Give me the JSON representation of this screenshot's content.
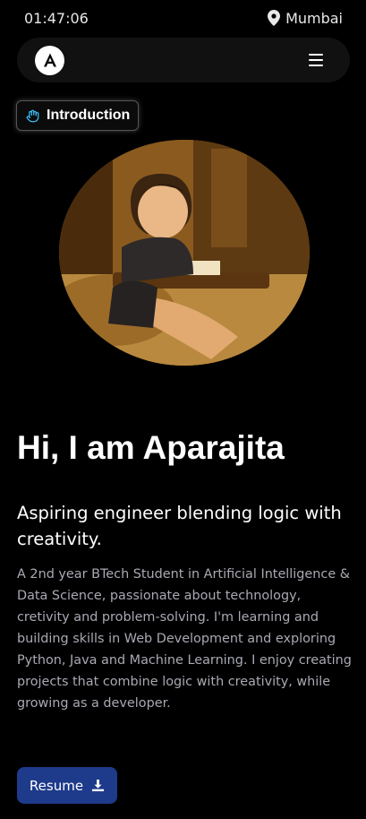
{
  "status_bar": {
    "time": "01:47:06",
    "location": "Mumbai",
    "location_icon": "map-pin-icon"
  },
  "navbar": {
    "logo_letter": "A",
    "menu_icon": "hamburger-menu-icon"
  },
  "intro_badge": {
    "label": "Introduction",
    "icon": "waving-hand-icon",
    "accent": "#38bdf8"
  },
  "hero": {
    "avatar": "profile-illustration",
    "headline": "Hi, I am Aparajita",
    "tagline": "Aspiring engineer blending logic with creativity.",
    "bio": "A 2nd year BTech Student in Artificial Intelligence & Data Science, passionate about technology, cretivity and problem-solving. I'm learning and building skills in Web Development and exploring Python, Java and Machine Learning. I enjoy creating projects that combine logic with creativity, while growing as a developer."
  },
  "actions": {
    "resume_label": "Resume",
    "resume_icon": "download-icon",
    "button_color": "#1e3a8a"
  }
}
